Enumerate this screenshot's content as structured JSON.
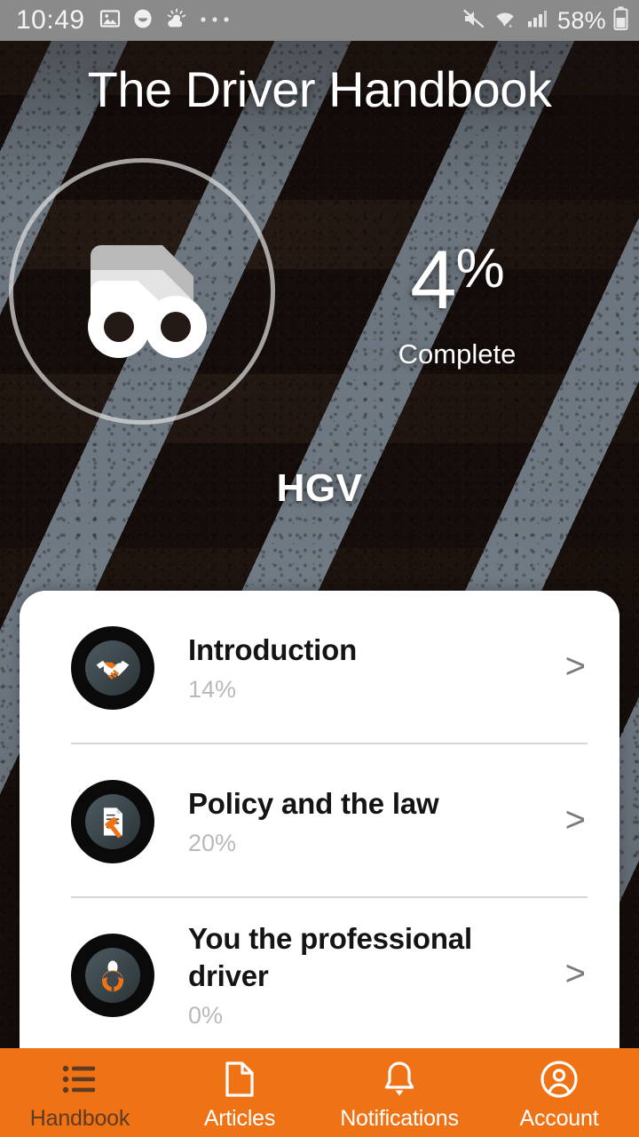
{
  "status_bar": {
    "time": "10:49",
    "left_icons": [
      "image-icon",
      "smiley-icon",
      "weather-icon",
      "more-dots-icon"
    ],
    "right_icons": [
      "mute-icon",
      "wifi-icon",
      "cellular-signal-icon"
    ],
    "battery_percent": "58%",
    "battery_icon": "battery-icon"
  },
  "header": {
    "title": "The Driver Handbook"
  },
  "vehicle": {
    "icon": "truck-icon",
    "type": "HGV",
    "progress_value": "4",
    "progress_symbol": "%",
    "progress_label": "Complete"
  },
  "sections": [
    {
      "title": "Introduction",
      "progress": "14%",
      "icon": "handshake-icon",
      "chevron": ">"
    },
    {
      "title": "Policy and the law",
      "progress": "20%",
      "icon": "gavel-document-icon",
      "chevron": ">"
    },
    {
      "title": "You the professional driver",
      "progress": "0%",
      "icon": "steering-wheel-driver-icon",
      "chevron": ">"
    }
  ],
  "bottom_nav": {
    "items": [
      {
        "label": "Handbook",
        "icon": "list-icon",
        "active": true
      },
      {
        "label": "Articles",
        "icon": "document-icon",
        "active": false
      },
      {
        "label": "Notifications",
        "icon": "bell-icon",
        "active": false
      },
      {
        "label": "Account",
        "icon": "account-circle-icon",
        "active": false
      }
    ]
  },
  "colors": {
    "accent_orange": "#ef7215",
    "card_white": "#ffffff",
    "active_nav_text": "#5e3b22",
    "progress_grey": "#b9b9b9",
    "status_bar_grey": "#8a8a8a"
  }
}
